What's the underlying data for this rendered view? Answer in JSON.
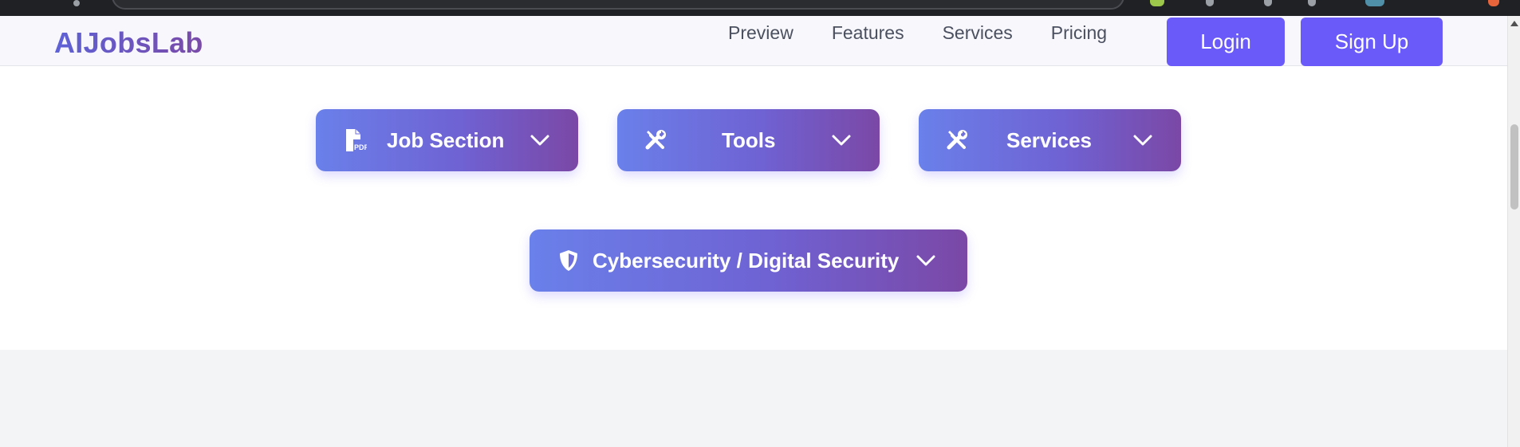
{
  "navbar": {
    "brand": "AIJobsLab",
    "links": [
      "Preview",
      "Features",
      "Services",
      "Pricing"
    ],
    "login_label": "Login",
    "signup_label": "Sign Up"
  },
  "sections": [
    {
      "label": "Job Section",
      "icon": "pdf-file-icon"
    },
    {
      "label": "Tools",
      "icon": "tools-icon"
    },
    {
      "label": "Services",
      "icon": "tools-icon"
    },
    {
      "label": "Cybersecurity / Digital Security",
      "icon": "shield-icon"
    }
  ],
  "colors": {
    "accent": "#6a5af9",
    "gradient_start": "#6a80ea",
    "gradient_end": "#7b48a6",
    "brand_text": "#6b55c9",
    "page_bg": "#f3f4f6",
    "panel_bg": "#ffffff"
  }
}
